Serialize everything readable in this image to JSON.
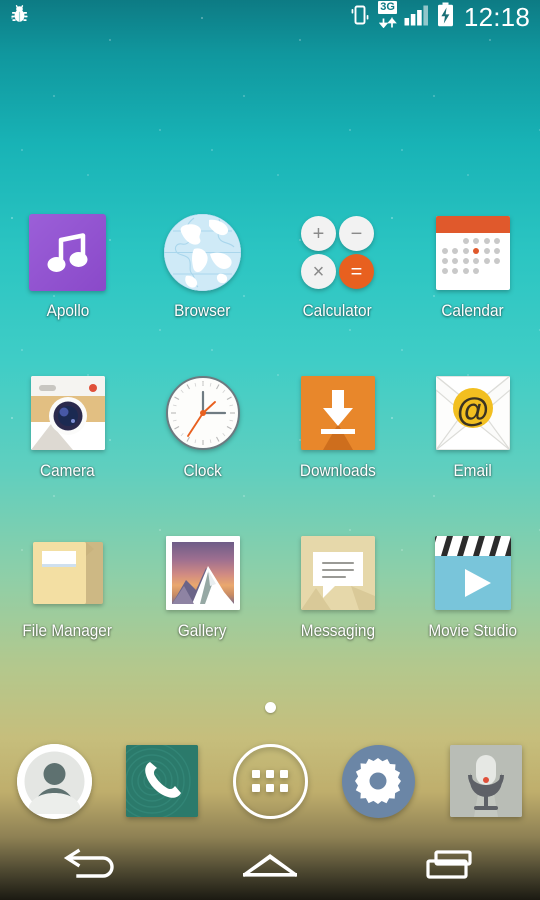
{
  "status_bar": {
    "debug_icon": "bug-icon",
    "vibrate_icon": "vibrate-icon",
    "network_type": "3G",
    "data_arrows_icon": "data-transfer-icon",
    "signal_icon": "signal-bars-icon",
    "battery_icon": "battery-charging-icon",
    "clock": "12:18"
  },
  "home_screen": {
    "rows": [
      [
        {
          "label": "Apollo",
          "icon": "apollo-music-icon"
        },
        {
          "label": "Browser",
          "icon": "browser-globe-icon"
        },
        {
          "label": "Calculator",
          "icon": "calculator-icon"
        },
        {
          "label": "Calendar",
          "icon": "calendar-icon"
        }
      ],
      [
        {
          "label": "Camera",
          "icon": "camera-icon"
        },
        {
          "label": "Clock",
          "icon": "clock-icon"
        },
        {
          "label": "Downloads",
          "icon": "downloads-icon"
        },
        {
          "label": "Email",
          "icon": "email-icon"
        }
      ],
      [
        {
          "label": "File Manager",
          "icon": "file-manager-folder-icon"
        },
        {
          "label": "Gallery",
          "icon": "gallery-photo-icon"
        },
        {
          "label": "Messaging",
          "icon": "messaging-bubble-icon"
        },
        {
          "label": "Movie Studio",
          "icon": "movie-studio-clapper-icon"
        }
      ]
    ],
    "page_indicator": {
      "pages": 1,
      "current": 1
    }
  },
  "calculator_icon": {
    "keys": [
      "+",
      "−",
      "×",
      "="
    ],
    "accent_color": "#e8601f"
  },
  "dock": {
    "items": [
      {
        "name": "people",
        "icon": "people-contacts-icon"
      },
      {
        "name": "phone",
        "icon": "phone-handset-icon"
      },
      {
        "name": "app-drawer",
        "icon": "app-drawer-icon"
      },
      {
        "name": "settings",
        "icon": "settings-gear-icon"
      },
      {
        "name": "sound-recorder",
        "icon": "microphone-icon"
      }
    ]
  },
  "nav_bar": {
    "back": "back-arrow-icon",
    "home": "home-icon",
    "recents": "recent-apps-icon"
  },
  "colors": {
    "wallpaper_top": "#0d7b84",
    "wallpaper_mid": "#3fcdc6",
    "wallpaper_bottom": "#c6be7c",
    "accent_orange": "#e8601f",
    "apollo_purple": "#8a49c9",
    "phone_teal": "#2b7a6b",
    "settings_blue": "#6b86a6"
  }
}
